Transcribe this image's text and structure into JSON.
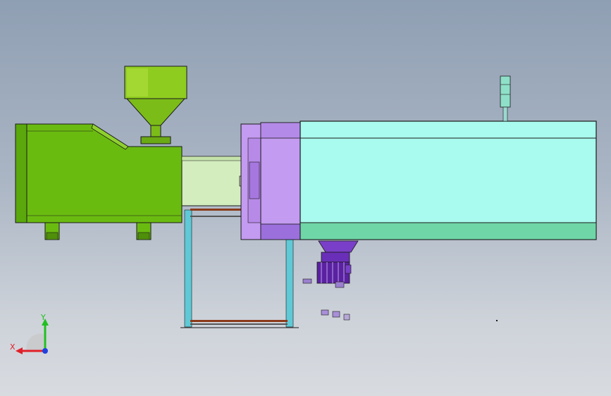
{
  "viewport": {
    "background_top": "#8f9fb3",
    "background_bottom": "#d8dbe0"
  },
  "model": {
    "colors": {
      "injection_unit": "#6abb10",
      "injection_unit_dark": "#4f8f0a",
      "hopper": "#8fcc20",
      "barrel_cover": "#d4edbf",
      "platen": "#c39bf0",
      "platen_dark": "#9b6fdc",
      "clamp_body": "#a8fbee",
      "clamp_base": "#6fd6a8",
      "outline": "#1a1a1a",
      "stand": "#5fc9d6",
      "stand_cross": "#8b3a1a",
      "motor": "#6a2fb8"
    },
    "parts": [
      "injection-unit",
      "hopper",
      "barrel-cover",
      "fixed-platen",
      "moving-platen",
      "clamp-unit",
      "signal-tower",
      "support-stand",
      "motor-assembly"
    ]
  },
  "triad": {
    "x_label": "X",
    "y_label": "Y",
    "x_color": "#e0202a",
    "y_color": "#20c020",
    "z_color": "#2040e0"
  }
}
